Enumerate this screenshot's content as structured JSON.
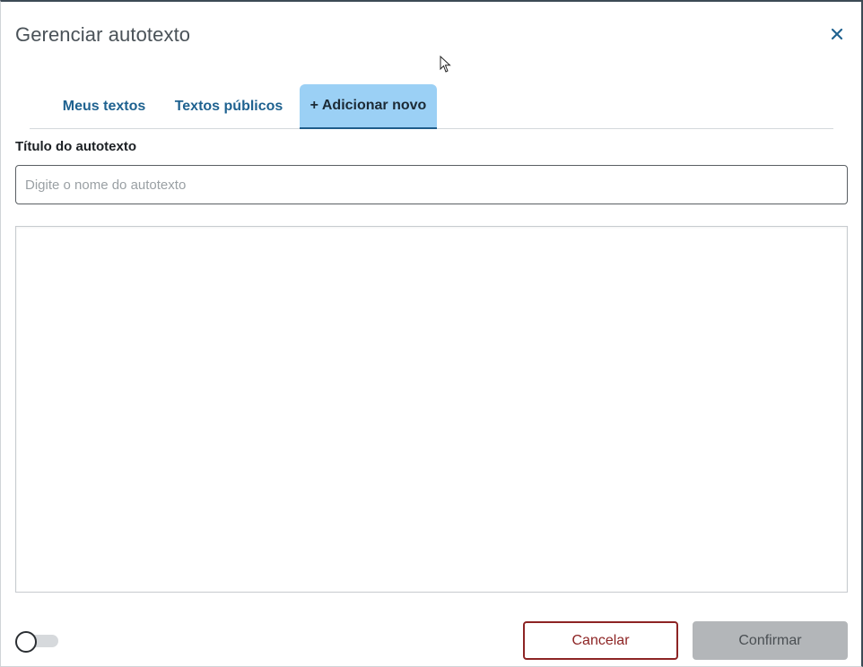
{
  "dialog": {
    "title": "Gerenciar autotexto",
    "close_icon": "close-icon"
  },
  "tabs": [
    {
      "label": "Meus textos",
      "active": false
    },
    {
      "label": "Textos públicos",
      "active": false
    },
    {
      "label": "+ Adicionar novo",
      "active": true
    }
  ],
  "form": {
    "title_label": "Título do autotexto",
    "title_placeholder": "Digite o nome do autotexto",
    "title_value": "",
    "body_value": ""
  },
  "toggle": {
    "on": false
  },
  "actions": {
    "cancel_label": "Cancelar",
    "confirm_label": "Confirmar"
  },
  "colors": {
    "primary": "#1f6290",
    "active_tab_bg": "#9bd0f5",
    "cancel": "#8d2424",
    "confirm_disabled": "#b3b6b9"
  }
}
